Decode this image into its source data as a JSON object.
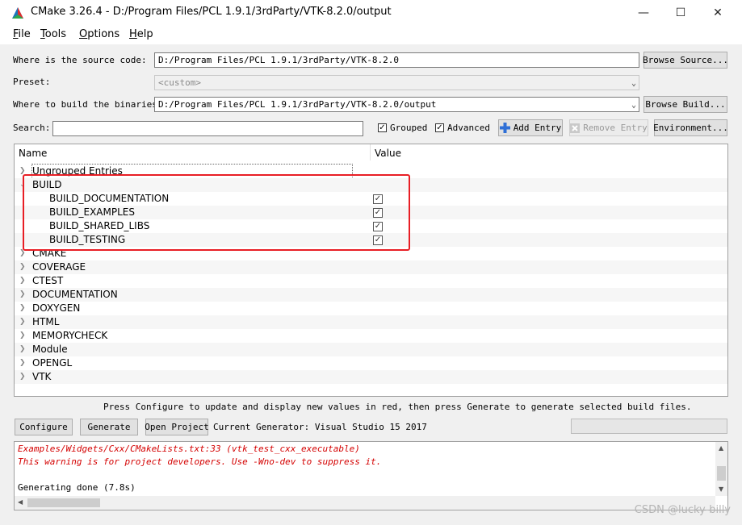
{
  "window": {
    "title": "CMake 3.26.4 - D:/Program Files/PCL 1.9.1/3rdParty/VTK-8.2.0/output",
    "minimize": "—",
    "maximize": "☐",
    "close": "✕",
    "icon": "cmake-triangle-icon"
  },
  "menu": [
    {
      "key": "F",
      "rest": "ile"
    },
    {
      "key": "T",
      "rest": "ools"
    },
    {
      "key": "O",
      "rest": "ptions"
    },
    {
      "key": "H",
      "rest": "elp"
    }
  ],
  "form": {
    "source_label": "Where is the source code:",
    "source_value": "D:/Program Files/PCL 1.9.1/3rdParty/VTK-8.2.0",
    "browse_source": "Browse Source...",
    "preset_label": "Preset:",
    "preset_value": "<custom>",
    "binaries_label": "Where to build the binaries:",
    "binaries_value": "D:/Program Files/PCL 1.9.1/3rdParty/VTK-8.2.0/output",
    "browse_build": "Browse Build...",
    "search_label": "Search:",
    "search_value": "",
    "grouped_label": "Grouped",
    "advanced_label": "Advanced",
    "add_entry": "Add Entry",
    "remove_entry": "Remove Entry",
    "environment": "Environment..."
  },
  "tree": {
    "col_name": "Name",
    "col_value": "Value",
    "groups_top": [
      "Ungrouped Entries"
    ],
    "build_group": "BUILD",
    "build_items": [
      "BUILD_DOCUMENTATION",
      "BUILD_EXAMPLES",
      "BUILD_SHARED_LIBS",
      "BUILD_TESTING"
    ],
    "groups_rest": [
      "CMAKE",
      "COVERAGE",
      "CTEST",
      "DOCUMENTATION",
      "DOXYGEN",
      "HTML",
      "MEMORYCHECK",
      "Module",
      "OPENGL",
      "VTK"
    ]
  },
  "hint": "Press Configure to update and display new values in red, then press Generate to generate selected build files.",
  "actions": {
    "configure": "Configure",
    "generate": "Generate",
    "open_project": "Open Project",
    "current_generator": "Current Generator: Visual Studio 15 2017"
  },
  "output": {
    "line1": "  Examples/Widgets/Cxx/CMakeLists.txt:33 (vtk_test_cxx_executable)",
    "line2": "This warning is for project developers.  Use -Wno-dev to suppress it.",
    "line3": "Generating done (7.8s)"
  },
  "watermark": "CSDN @lucky-billy",
  "colors": {
    "highlight": "#e81e25",
    "warning_text": "#d40000"
  }
}
